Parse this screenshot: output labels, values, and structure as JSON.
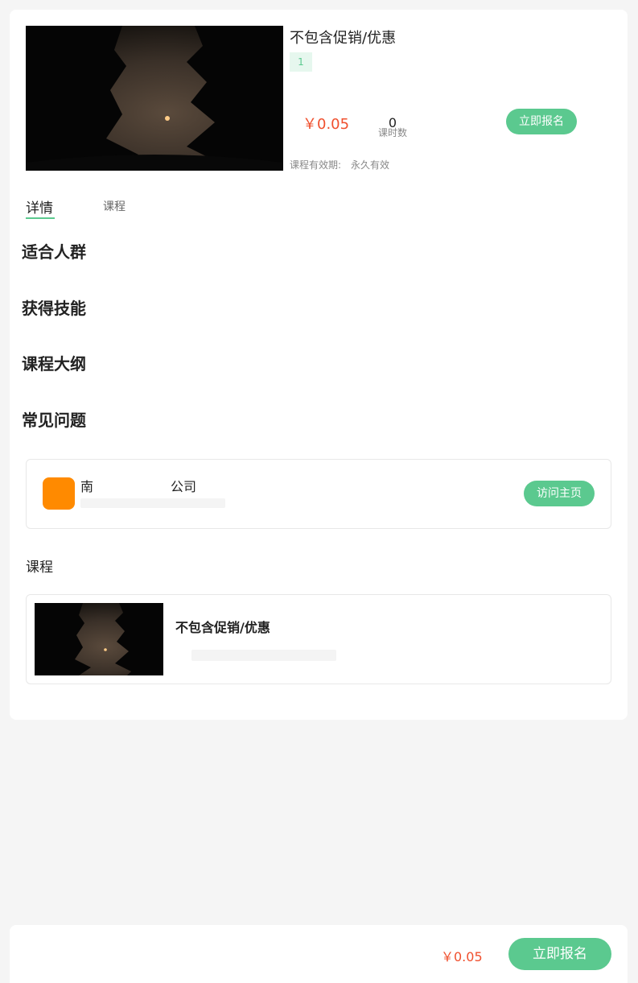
{
  "course": {
    "title": "不包含促销/优惠",
    "tag": "1",
    "price": "￥0.05",
    "lesson_count": "0",
    "lesson_count_label": "课时数",
    "enroll_label": "立即报名",
    "validity_label": "课程有效期:",
    "validity_value": "永久有效"
  },
  "tabs": [
    {
      "label": "详情",
      "active": true
    },
    {
      "label": "课程",
      "active": false
    }
  ],
  "sections": {
    "audience": "适合人群",
    "skills": "获得技能",
    "outline": "课程大纲",
    "faq": "常见问题"
  },
  "org": {
    "name": "南　　　　　　公司",
    "visit_label": "访问主页"
  },
  "course_list": {
    "heading": "课程",
    "items": [
      {
        "title": "不包含促销/优惠"
      }
    ]
  },
  "bottom_bar": {
    "price": "￥0.05",
    "enroll_label": "立即报名"
  },
  "colors": {
    "accent_green": "#5bc98f",
    "price_red": "#f0502e",
    "org_logo_orange": "#ff8a00"
  }
}
